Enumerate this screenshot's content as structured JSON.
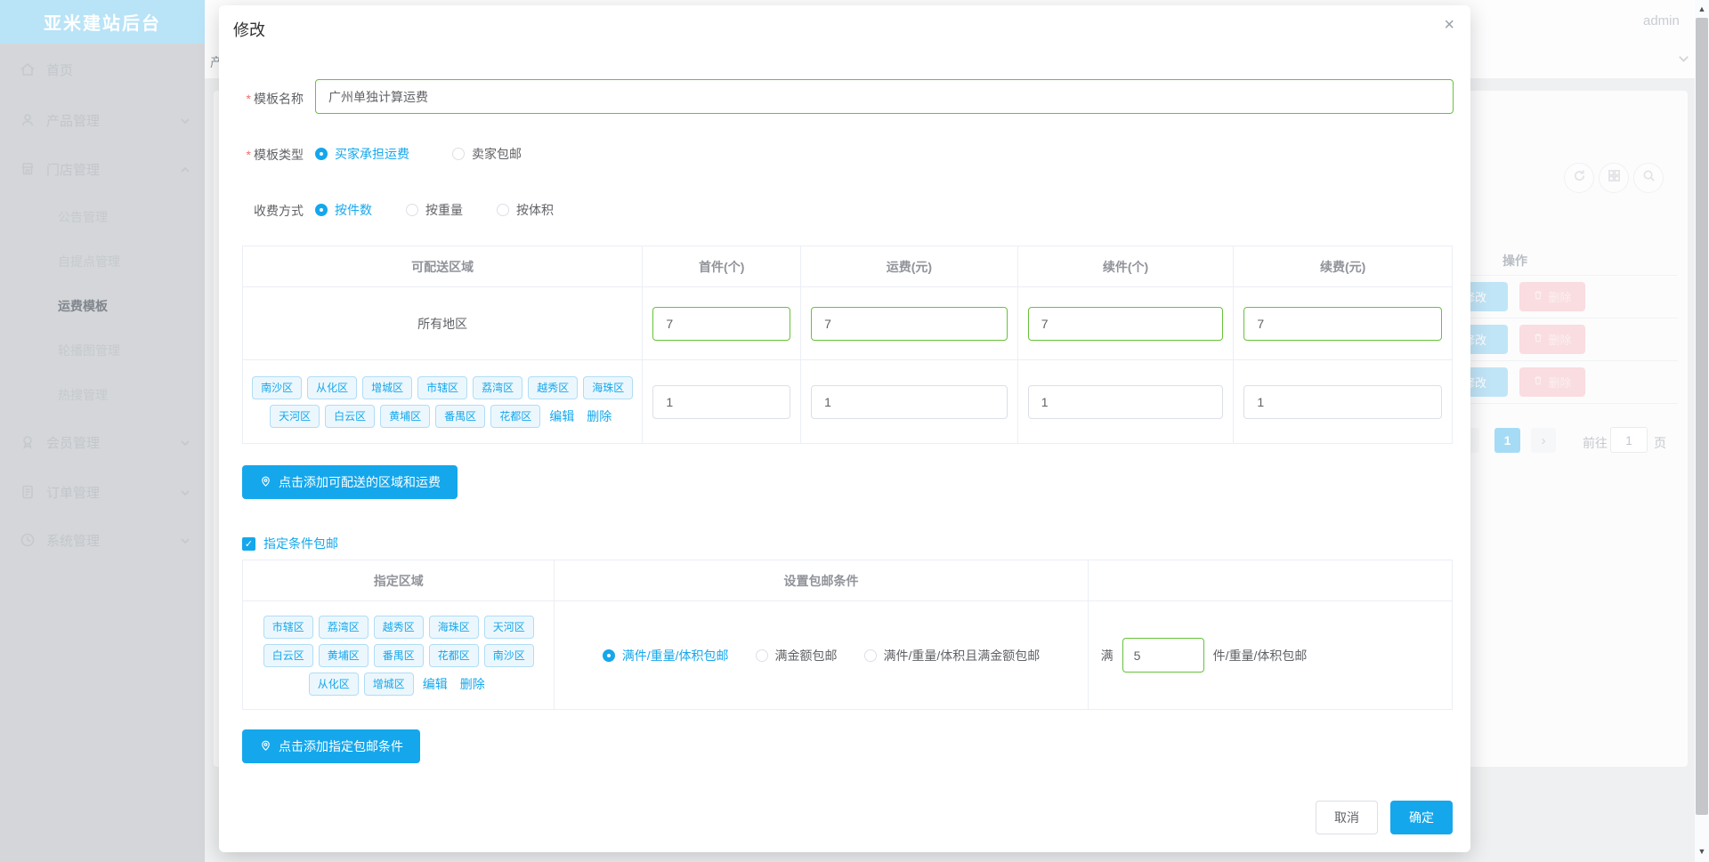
{
  "app": {
    "sidebar_title": "亚米建站后台",
    "user": "admin",
    "breadcrumb_partial": "产"
  },
  "colors": {
    "accent": "#15a7ec",
    "valid_green": "#67c23a",
    "danger": "#f56c6c"
  },
  "icons": {
    "home": "home-icon",
    "product": "user-icon",
    "store": "shop-icon",
    "member": "medal-icon",
    "order": "document-icon",
    "system": "clock-icon",
    "pin": "location-pin-icon",
    "close": "×",
    "check": "✓",
    "scroll_up": "▲",
    "scroll_down": "▼",
    "prev": "‹",
    "next": "›"
  },
  "sidebar": {
    "items": [
      {
        "label": "首页"
      },
      {
        "label": "产品管理"
      },
      {
        "label": "门店管理",
        "children": [
          "公告管理",
          "自提点管理",
          "运费模板",
          "轮播图管理",
          "热搜管理"
        ],
        "active_child": "运费模板"
      },
      {
        "label": "会员管理"
      },
      {
        "label": "订单管理"
      },
      {
        "label": "系统管理"
      }
    ]
  },
  "background": {
    "op_header": "操作",
    "rows": [
      {
        "edit": "修改",
        "delete": "删除"
      },
      {
        "edit": "修改",
        "delete": "删除"
      },
      {
        "edit": "修改",
        "delete": "删除"
      }
    ],
    "pagination": {
      "prev": "‹",
      "current": "1",
      "next": "›",
      "goto_label": "前往",
      "goto_value": "1",
      "page_label": "页"
    }
  },
  "modal": {
    "title": "修改",
    "close": "×",
    "name_field": {
      "label": "模板名称",
      "value": "广州单独计算运费"
    },
    "type_field": {
      "label": "模板类型",
      "options": [
        {
          "label": "买家承担运费",
          "selected": true
        },
        {
          "label": "卖家包邮",
          "selected": false
        }
      ]
    },
    "charge_field": {
      "label": "收费方式",
      "options": [
        {
          "label": "按件数",
          "selected": true
        },
        {
          "label": "按重量",
          "selected": false
        },
        {
          "label": "按体积",
          "selected": false
        }
      ]
    },
    "shipping_table": {
      "headers": [
        "可配送区域",
        "首件(个)",
        "运费(元)",
        "续件(个)",
        "续费(元)"
      ],
      "rows": [
        {
          "region": "所有地区",
          "first": "7",
          "fee": "7",
          "additional": "7",
          "additional_fee": "7"
        },
        {
          "regions": [
            "南沙区",
            "从化区",
            "增城区",
            "市辖区",
            "荔湾区",
            "越秀区",
            "海珠区",
            "天河区",
            "白云区",
            "黄埔区",
            "番禺区",
            "花都区"
          ],
          "edit": "编辑",
          "delete": "删除",
          "first": "1",
          "fee": "1",
          "additional": "1",
          "additional_fee": "1"
        }
      ]
    },
    "add_region_button": "点击添加可配送的区域和运费",
    "free_condition_checkbox": {
      "label": "指定条件包邮",
      "checked": true
    },
    "condition_table": {
      "headers": [
        "指定区域",
        "设置包邮条件",
        ""
      ],
      "regions": [
        "市辖区",
        "荔湾区",
        "越秀区",
        "海珠区",
        "天河区",
        "白云区",
        "黄埔区",
        "番禺区",
        "花都区",
        "南沙区",
        "从化区",
        "增城区"
      ],
      "edit": "编辑",
      "delete": "删除",
      "options": [
        {
          "label": "满件/重量/体积包邮",
          "selected": true
        },
        {
          "label": "满金额包邮",
          "selected": false
        },
        {
          "label": "满件/重量/体积且满金额包邮",
          "selected": false
        }
      ],
      "condition_input": {
        "prefix": "满",
        "value": "5",
        "suffix": "件/重量/体积包邮"
      }
    },
    "add_condition_button": "点击添加指定包邮条件",
    "footer": {
      "cancel": "取消",
      "confirm": "确定"
    }
  }
}
